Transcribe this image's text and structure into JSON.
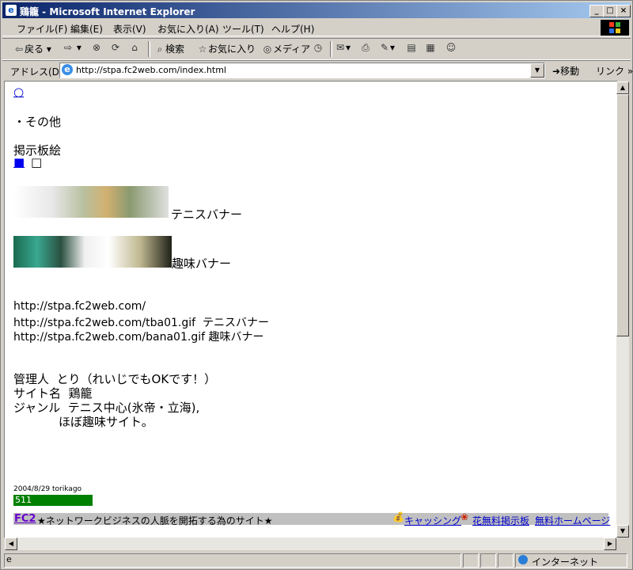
{
  "window": {
    "title": "鶏籠 - Microsoft Internet Explorer"
  },
  "menu": [
    "ファイル(F)",
    "編集(E)",
    "表示(V)",
    "お気に入り(A)",
    "ツール(T)",
    "ヘルプ(H)"
  ],
  "toolbar": {
    "back": "戻る",
    "search": "検索",
    "favorites": "お気に入り",
    "media": "メディア"
  },
  "address": {
    "label": "アドレス(D)",
    "url": "http://stpa.fc2web.com/index.html",
    "go": "移動",
    "links": "リンク"
  },
  "page": {
    "circle_link": "○",
    "section_other": "・その他",
    "board_title": "掲示板絵",
    "board_links": [
      "■",
      "□"
    ],
    "tennis_banner_label": "テニスバナー",
    "hobby_banner_label": "趣味バナー",
    "urls": [
      "http://stpa.fc2web.com/",
      "http://stpa.fc2web.com/tba01.gif  テニスバナー",
      "http://stpa.fc2web.com/bana01.gif 趣味バナー"
    ],
    "info": [
      "管理人  とり（れいじでもOKです！）",
      "サイト名  鶏籠",
      "ジャンル  テニス中心(氷帝・立海),",
      "ほぼ趣味サイト。"
    ],
    "counter_caption": "2004/8/29 torikago",
    "counter_value": "511"
  },
  "footer": {
    "fc2": "FC2",
    "slogan": "★ネットワークビジネスの人脈を開拓する為のサイト★",
    "link1": "キャッシング",
    "link2": "花無料掲示板",
    "link3": "無料ホームページ"
  },
  "status": {
    "zone": "インターネット"
  },
  "colors": {
    "titlebar": "#0a246a",
    "counter": "#008000",
    "link": "#0000cc"
  }
}
